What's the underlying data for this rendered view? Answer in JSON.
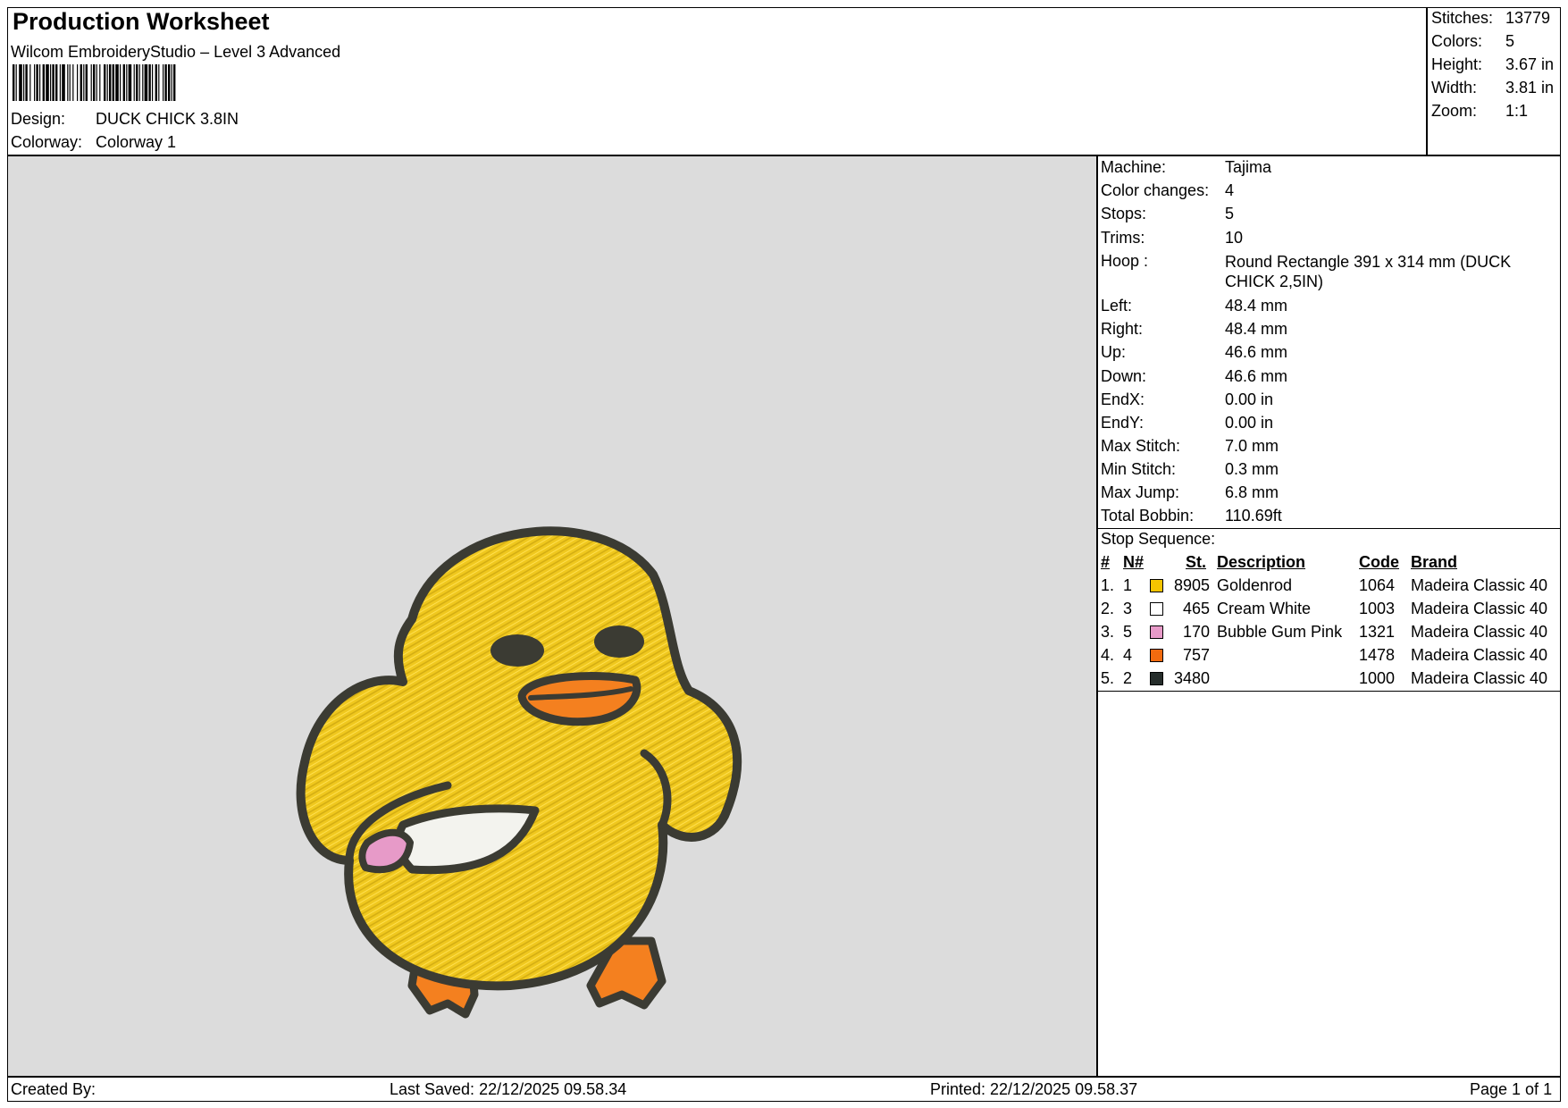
{
  "header": {
    "title": "Production Worksheet",
    "subtitle": "Wilcom EmbroideryStudio – Level 3 Advanced",
    "design_label": "Design:",
    "design_value": "DUCK CHICK 3.8IN",
    "colorway_label": "Colorway:",
    "colorway_value": "Colorway 1"
  },
  "summary": [
    {
      "label": "Stitches:",
      "value": "13779"
    },
    {
      "label": "Colors:",
      "value": "5"
    },
    {
      "label": "Height:",
      "value": "3.67 in"
    },
    {
      "label": "Width:",
      "value": "3.81 in"
    },
    {
      "label": "Zoom:",
      "value": "1:1"
    }
  ],
  "info": [
    {
      "label": "Machine:",
      "value": "Tajima"
    },
    {
      "label": "Color changes:",
      "value": "4"
    },
    {
      "label": "Stops:",
      "value": "5"
    },
    {
      "label": "Trims:",
      "value": "10"
    },
    {
      "label": "Hoop :",
      "value": "Round Rectangle 391 x 314 mm (DUCK CHICK 2,5IN)"
    },
    {
      "label": "Left:",
      "value": "48.4 mm"
    },
    {
      "label": "Right:",
      "value": "48.4 mm"
    },
    {
      "label": "Up:",
      "value": "46.6 mm"
    },
    {
      "label": "Down:",
      "value": "46.6 mm"
    },
    {
      "label": "EndX:",
      "value": "0.00 in"
    },
    {
      "label": "EndY:",
      "value": "0.00 in"
    },
    {
      "label": "Max Stitch:",
      "value": "7.0 mm"
    },
    {
      "label": "Min Stitch:",
      "value": "0.3 mm"
    },
    {
      "label": "Max Jump:",
      "value": "6.8 mm"
    },
    {
      "label": "Total Bobbin:",
      "value": "110.69ft"
    }
  ],
  "stop_sequence": {
    "title": "Stop Sequence:",
    "headers": {
      "idx": "#",
      "needle": "N#",
      "stitches": "St.",
      "description": "Description",
      "code": "Code",
      "brand": "Brand"
    },
    "rows": [
      {
        "idx": "1.",
        "needle": "1",
        "color": "#f5c400",
        "stitches": "8905",
        "description": "Goldenrod",
        "code": "1064",
        "brand": "Madeira Classic 40"
      },
      {
        "idx": "2.",
        "needle": "3",
        "color": "#ffffff",
        "stitches": "465",
        "description": "Cream White",
        "code": "1003",
        "brand": "Madeira Classic 40"
      },
      {
        "idx": "3.",
        "needle": "5",
        "color": "#e79ac8",
        "stitches": "170",
        "description": "Bubble Gum Pink",
        "code": "1321",
        "brand": "Madeira Classic 40"
      },
      {
        "idx": "4.",
        "needle": "4",
        "color": "#f26b0f",
        "stitches": "757",
        "description": "",
        "code": "1478",
        "brand": "Madeira Classic 40"
      },
      {
        "idx": "5.",
        "needle": "2",
        "color": "#262d2b",
        "stitches": "3480",
        "description": "",
        "code": "1000",
        "brand": "Madeira Classic 40"
      }
    ]
  },
  "footer": {
    "created_by": "Created By:",
    "last_saved": "Last Saved: 22/12/2025 09.58.34",
    "printed": "Printed: 22/12/2025 09.58.37",
    "page": "Page 1 of 1"
  }
}
